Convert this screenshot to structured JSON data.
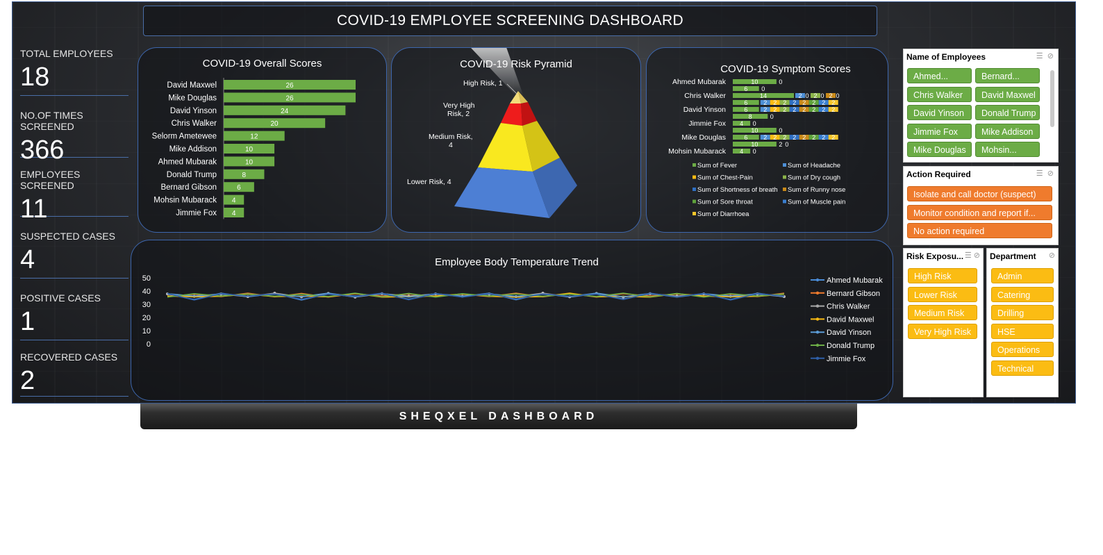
{
  "dashboard": {
    "title": "COVID-19 EMPLOYEE SCREENING DASHBOARD",
    "footer": "SHEQXEL DASHBOARD"
  },
  "kpis": [
    {
      "label": "TOTAL EMPLOYEES",
      "value": "18"
    },
    {
      "label": "NO.OF TIMES SCREENED",
      "value": "366"
    },
    {
      "label": "EMPLOYEES SCREENED",
      "value": "11"
    },
    {
      "label": "SUSPECTED CASES",
      "value": "4"
    },
    {
      "label": "POSITIVE CASES",
      "value": "1"
    },
    {
      "label": "RECOVERED CASES",
      "value": "2"
    }
  ],
  "overall_scores": {
    "title": "COVID-19 Overall Scores",
    "names": [
      "David Maxwel",
      "Mike Douglas",
      "David Yinson",
      "Chris Walker",
      "Selorm Ametewee",
      "Mike Addison",
      "Ahmed Mubarak",
      "Donald Trump",
      "Bernard Gibson",
      "Mohsin Mubarack",
      "Jimmie Fox"
    ],
    "values": [
      26,
      26,
      24,
      20,
      12,
      10,
      10,
      8,
      6,
      4,
      4
    ],
    "color": "#6cac46"
  },
  "pyramid": {
    "title": "COVID-19 Risk Pyramid",
    "levels": [
      {
        "label": "High Risk, 1",
        "color": "#f5d76e"
      },
      {
        "label": "Very High Risk, 2",
        "color": "#ee1c1c"
      },
      {
        "label": "Medium Risk, 4",
        "color": "#f9e81f"
      },
      {
        "label": "Lower Risk, 4",
        "color": "#4d7fd4"
      }
    ]
  },
  "symptom_scores": {
    "title": "COVID-19 Symptom Scores",
    "names": [
      "Ahmed Mubarak",
      "Chris Walker",
      "David Yinson",
      "Jimmie Fox",
      "Mike Douglas",
      "Mohsin Mubarack"
    ],
    "row_labels": [
      {
        "seg": "10",
        "tail": "0"
      },
      {
        "seg": "6",
        "tail": "0"
      },
      {
        "seg": "14",
        "tail": "2 0 2 0 2 0"
      },
      {
        "seg": "6",
        "tail": "2 2 2 2 2 2 2 2"
      },
      {
        "seg": "6",
        "tail": "2 2 2 2 2 2 2 2"
      },
      {
        "seg": "8",
        "tail": "0"
      },
      {
        "seg": "4",
        "tail": "0"
      },
      {
        "seg": "10",
        "tail": "0"
      },
      {
        "seg": "6",
        "tail": "2 2 2 2 2 2 2 2"
      },
      {
        "seg": "10",
        "tail": "2 0"
      },
      {
        "seg": "4",
        "tail": "0"
      }
    ],
    "legend": [
      {
        "name": "Sum of Fever",
        "color": "#6cac46"
      },
      {
        "name": "Sum of Headache",
        "color": "#4d8fd6"
      },
      {
        "name": "Sum of Chest-Pain",
        "color": "#fbbc13"
      },
      {
        "name": "Sum of Dry cough",
        "color": "#8bb34a"
      },
      {
        "name": "Sum of Shortness of breath",
        "color": "#2f6fc2"
      },
      {
        "name": "Sum of Runny nose",
        "color": "#c98a1a"
      },
      {
        "name": "Sum of Sore throat",
        "color": "#5fa33c"
      },
      {
        "name": "Sum of Muscle pain",
        "color": "#3a7fd0"
      },
      {
        "name": "Sum of Diarrhoea",
        "color": "#f7c52a"
      }
    ]
  },
  "temperature": {
    "title": "Employee Body Temperature Trend",
    "yticks": [
      "50",
      "40",
      "30",
      "20",
      "10",
      "0"
    ],
    "series": [
      {
        "name": "Ahmed Mubarak",
        "color": "#4a8bd6"
      },
      {
        "name": "Bernard Gibson",
        "color": "#ef7b2d"
      },
      {
        "name": "Chris Walker",
        "color": "#a8a8a8"
      },
      {
        "name": "David Maxwel",
        "color": "#fbbc13"
      },
      {
        "name": "David Yinson",
        "color": "#5b9bd5"
      },
      {
        "name": "Donald Trump",
        "color": "#6cac46"
      },
      {
        "name": "Jimmie Fox",
        "color": "#2f5fa8"
      }
    ]
  },
  "slicers": {
    "employees": {
      "title": "Name of Employees",
      "items": [
        "Ahmed...",
        "Bernard...",
        "Chris Walker",
        "David Maxwel",
        "David Yinson",
        "Donald Trump",
        "Jimmie Fox",
        "Mike Addison",
        "Mike Douglas",
        "Mohsin..."
      ]
    },
    "action": {
      "title": "Action Required",
      "items": [
        "Isolate and call doctor (suspect)",
        "Monitor condition and report if...",
        "No action required"
      ]
    },
    "risk": {
      "title": "Risk Exposu...",
      "items": [
        "High Risk",
        "Lower Risk",
        "Medium Risk",
        "Very High Risk"
      ]
    },
    "department": {
      "title": "Department",
      "items": [
        "Admin",
        "Catering",
        "Drilling",
        "HSE",
        "Operations",
        "Technical"
      ]
    }
  }
}
